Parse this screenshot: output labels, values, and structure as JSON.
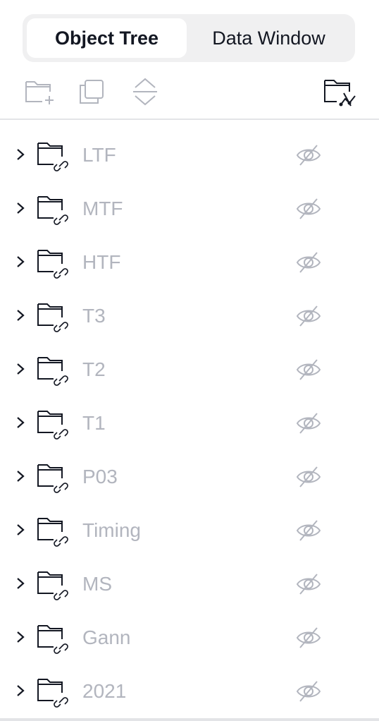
{
  "tabs": [
    {
      "label": "Object Tree",
      "active": true
    },
    {
      "label": "Data Window",
      "active": false
    }
  ],
  "toolbar": {
    "icons": [
      "new-group-icon",
      "clone-icon",
      "collapse-expand-icon",
      "manage-drawings-icon"
    ]
  },
  "tree": {
    "items": [
      {
        "label": "LTF",
        "visible": false
      },
      {
        "label": "MTF",
        "visible": false
      },
      {
        "label": "HTF",
        "visible": false
      },
      {
        "label": "T3",
        "visible": false
      },
      {
        "label": "T2",
        "visible": false
      },
      {
        "label": "T1",
        "visible": false
      },
      {
        "label": "P03",
        "visible": false
      },
      {
        "label": "Timing",
        "visible": false
      },
      {
        "label": "MS",
        "visible": false
      },
      {
        "label": "Gann",
        "visible": false
      },
      {
        "label": "2021",
        "visible": false
      }
    ]
  },
  "colors": {
    "text": "#131722",
    "muted": "#b2b5be",
    "icon_light": "#b2b5be",
    "tab_bg": "#f0f0f1"
  }
}
